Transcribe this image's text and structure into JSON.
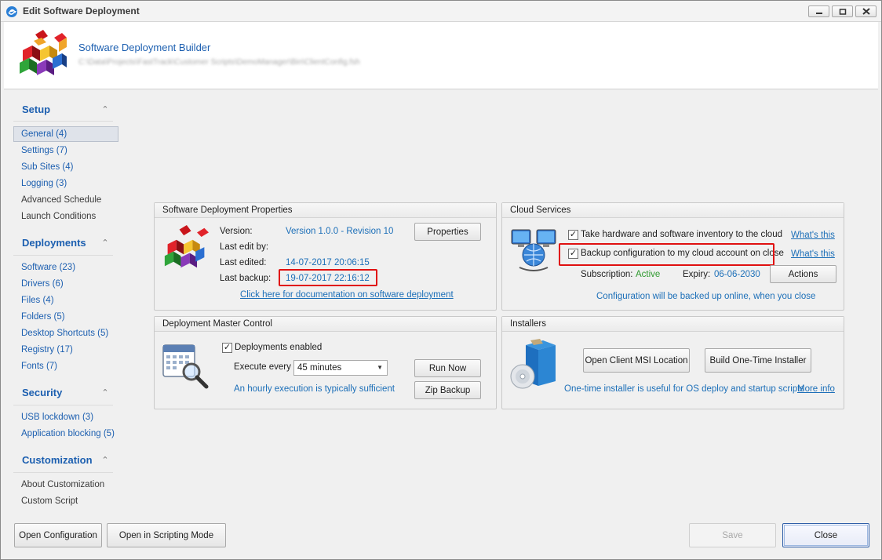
{
  "window": {
    "title": "Edit Software Deployment"
  },
  "header": {
    "title": "Software Deployment Builder",
    "path": "C:\\Data\\Projects\\FastTrack\\Customer Scripts\\DemoManager\\Bin\\ClientConfig.fsh"
  },
  "sidebar": {
    "sections": [
      {
        "title": "Setup",
        "items": [
          "General (4)",
          "Settings (7)",
          "Sub Sites (4)",
          "Logging (3)",
          "Advanced Schedule",
          "Launch Conditions"
        ]
      },
      {
        "title": "Deployments",
        "items": [
          "Software (23)",
          "Drivers (6)",
          "Files (4)",
          "Folders (5)",
          "Desktop Shortcuts (5)",
          "Registry (17)",
          "Fonts (7)"
        ]
      },
      {
        "title": "Security",
        "items": [
          "USB lockdown (3)",
          "Application blocking (5)"
        ]
      },
      {
        "title": "Customization",
        "items": [
          "About Customization",
          "Custom Script"
        ]
      }
    ],
    "selected": "General (4)"
  },
  "properties_panel": {
    "title": "Software Deployment Properties",
    "version_label": "Version:",
    "version_value": "Version 1.0.0 - Revision 10",
    "last_edit_by_label": "Last edit by:",
    "last_edited_label": "Last edited:",
    "last_edited_value": "14-07-2017 20:06:15",
    "last_backup_label": "Last backup:",
    "last_backup_value": "19-07-2017 22:16:12",
    "properties_button": "Properties",
    "doc_link": "Click here for documentation on software deployment"
  },
  "cloud_panel": {
    "title": "Cloud Services",
    "inventory_label": "Take hardware and software inventory to the cloud",
    "inventory_checked": true,
    "backup_label": "Backup configuration to my cloud account on close",
    "backup_checked": true,
    "whats_this_1": "What's this",
    "whats_this_2": "What's this",
    "subscription_label": "Subscription:",
    "subscription_value": "Active",
    "expiry_label": "Expiry:",
    "expiry_value": "06-06-2030",
    "actions_button": "Actions",
    "note": "Configuration will be backed up online, when you close"
  },
  "master_panel": {
    "title": "Deployment Master Control",
    "enabled_label": "Deployments enabled",
    "enabled_checked": true,
    "execute_label": "Execute every",
    "execute_value": "45 minutes",
    "run_now_button": "Run Now",
    "zip_backup_button": "Zip Backup",
    "note": "An hourly execution is typically sufficient"
  },
  "installers_panel": {
    "title": "Installers",
    "open_msi_button": "Open Client MSI Location",
    "build_installer_button": "Build One-Time Installer",
    "note": "One-time installer is useful for OS deploy and startup scripts",
    "more_info": "More info"
  },
  "footer": {
    "open_config_button": "Open Configuration",
    "scripting_button": "Open in Scripting Mode",
    "save_button": "Save",
    "close_button": "Close"
  },
  "colors": {
    "link": "#1c6fb8",
    "heading": "#1c5fb0",
    "highlight": "#e01010",
    "active": "#2f9a2f"
  }
}
